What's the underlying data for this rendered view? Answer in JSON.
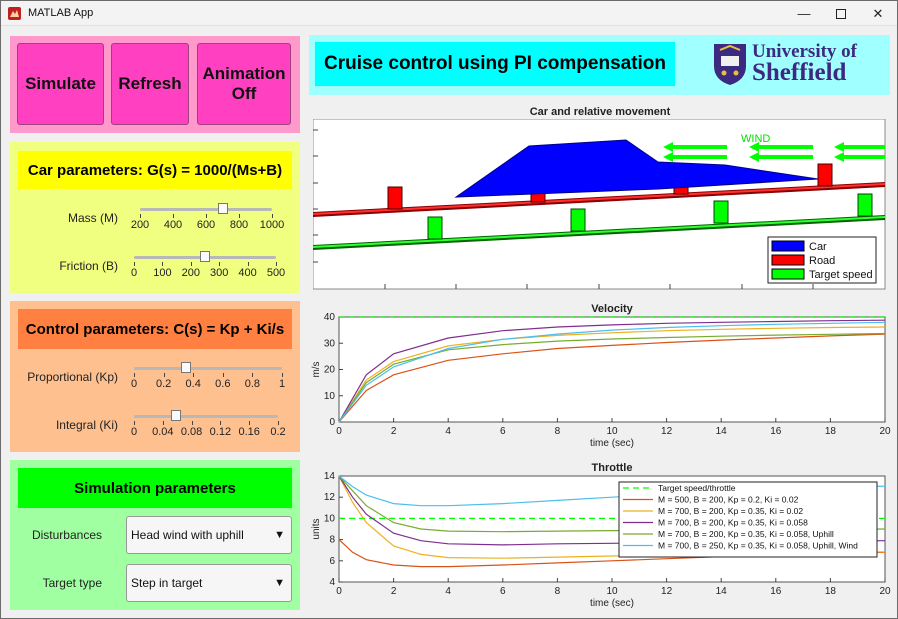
{
  "window": {
    "title": "MATLAB App"
  },
  "buttons": {
    "simulate": "Simulate",
    "refresh": "Refresh",
    "animation_line1": "Animation",
    "animation_line2": "Off"
  },
  "header": {
    "title": "Cruise control using PI compensation",
    "logo_line1": "University of",
    "logo_line2": "Sheffield"
  },
  "car_params": {
    "title": "Car parameters:  G(s) = 1000/(Ms+B)",
    "mass_label": "Mass (M)",
    "mass_ticks": [
      "200",
      "400",
      "600",
      "800",
      "1000"
    ],
    "mass_value": 700,
    "mass_min": 200,
    "mass_max": 1000,
    "friction_label": "Friction (B)",
    "friction_ticks": [
      "0",
      "100",
      "200",
      "300",
      "400",
      "500"
    ],
    "friction_value": 250,
    "friction_min": 0,
    "friction_max": 500
  },
  "control_params": {
    "title": "Control parameters: C(s) = Kp + Ki/s",
    "kp_label": "Proportional (Kp)",
    "kp_ticks": [
      "0",
      "0.2",
      "0.4",
      "0.6",
      "0.8",
      "1"
    ],
    "kp_value": 0.35,
    "kp_min": 0,
    "kp_max": 1,
    "ki_label": "Integral (Ki)",
    "ki_ticks": [
      "0",
      "0.04",
      "0.08",
      "0.12",
      "0.16",
      "0.2"
    ],
    "ki_value": 0.058,
    "ki_min": 0,
    "ki_max": 0.2
  },
  "sim_params": {
    "title": "Simulation parameters",
    "disturbances_label": "Disturbances",
    "disturbances_value": "Head wind with uphill",
    "target_label": "Target type",
    "target_value": "Step in target"
  },
  "colors": {
    "pink": "#ff40c0",
    "yellow": "#ffff00",
    "orange": "#ff8040",
    "green": "#00ff00",
    "cyan": "#00ffff"
  },
  "chart_data": [
    {
      "type": "animation",
      "title": "Car and relative movement",
      "wind_label": "WIND",
      "legend": [
        "Car",
        "Road",
        "Target speed"
      ],
      "legend_colors": [
        "#0000ff",
        "#ff0000",
        "#00ff00"
      ]
    },
    {
      "type": "line",
      "title": "Velocity",
      "xlabel": "time (sec)",
      "ylabel": "m/s",
      "xlim": [
        0,
        20
      ],
      "ylim": [
        0,
        40
      ],
      "xticks": [
        "0",
        "2",
        "4",
        "6",
        "8",
        "10",
        "12",
        "14",
        "16",
        "18",
        "20"
      ],
      "yticks": [
        "0",
        "10",
        "20",
        "30",
        "40"
      ],
      "target": 40,
      "series": [
        {
          "color": "#d95319",
          "x": [
            0,
            1,
            2,
            4,
            6,
            8,
            10,
            12,
            14,
            16,
            18,
            20
          ],
          "values": [
            0,
            12,
            18,
            23.5,
            26,
            28,
            29.2,
            30.3,
            31.2,
            32,
            32.8,
            33.5
          ]
        },
        {
          "color": "#edb120",
          "x": [
            0,
            1,
            2,
            4,
            6,
            8,
            10,
            12,
            14,
            16,
            18,
            20
          ],
          "values": [
            0,
            16,
            23,
            29,
            31.5,
            33,
            34,
            34.8,
            35.3,
            35.7,
            36,
            36.2
          ]
        },
        {
          "color": "#7e2f8e",
          "x": [
            0,
            1,
            2,
            4,
            6,
            8,
            10,
            12,
            14,
            16,
            18,
            20
          ],
          "values": [
            0,
            18,
            26,
            32,
            34.8,
            36.2,
            37,
            37.6,
            38,
            38.3,
            38.6,
            38.8
          ]
        },
        {
          "color": "#77ac30",
          "x": [
            0,
            1,
            2,
            4,
            6,
            8,
            10,
            12,
            14,
            16,
            18,
            20
          ],
          "values": [
            0,
            15,
            22,
            27.5,
            29.5,
            30.8,
            31.6,
            32.2,
            32.7,
            33.1,
            33.4,
            33.7
          ]
        },
        {
          "color": "#4dbeee",
          "x": [
            0,
            1,
            2,
            4,
            6,
            8,
            10,
            12,
            14,
            16,
            18,
            20
          ],
          "values": [
            0,
            14,
            21,
            28,
            31.5,
            33.5,
            35,
            36,
            36.7,
            37.2,
            37.6,
            38
          ]
        }
      ]
    },
    {
      "type": "line",
      "title": "Throttle",
      "xlabel": "time (sec)",
      "ylabel": "units",
      "xlim": [
        0,
        20
      ],
      "ylim": [
        4,
        14
      ],
      "xticks": [
        "0",
        "2",
        "4",
        "6",
        "8",
        "10",
        "12",
        "14",
        "16",
        "18",
        "20"
      ],
      "yticks": [
        "4",
        "6",
        "8",
        "10",
        "12",
        "14"
      ],
      "target": 10,
      "series": [
        {
          "name": "Target speed/throttle",
          "color": "#00ff00",
          "dashed": true,
          "x": [
            0,
            20
          ],
          "values": [
            10,
            10
          ]
        },
        {
          "name": "M = 500, B = 200, Kp = 0.2, Ki = 0.02",
          "color": "#d95319",
          "x": [
            0,
            0.5,
            1,
            2,
            3,
            4,
            6,
            8,
            10,
            12,
            14,
            16,
            18,
            20
          ],
          "values": [
            8,
            6.8,
            6.1,
            5.6,
            5.45,
            5.45,
            5.6,
            5.8,
            6.0,
            6.2,
            6.4,
            6.55,
            6.7,
            6.8
          ]
        },
        {
          "name": "M = 700, B = 200, Kp = 0.35, Ki = 0.02",
          "color": "#edb120",
          "x": [
            0,
            0.5,
            1,
            2,
            3,
            4,
            6,
            8,
            10,
            12,
            14,
            16,
            18,
            20
          ],
          "values": [
            14,
            11.5,
            9.6,
            7.4,
            6.6,
            6.3,
            6.25,
            6.35,
            6.45,
            6.55,
            6.65,
            6.75,
            6.8,
            6.85
          ]
        },
        {
          "name": "M = 700, B = 200, Kp = 0.35, Ki = 0.058",
          "color": "#7e2f8e",
          "x": [
            0,
            0.5,
            1,
            2,
            3,
            4,
            6,
            8,
            10,
            12,
            14,
            16,
            18,
            20
          ],
          "values": [
            14,
            12,
            10.4,
            8.6,
            7.9,
            7.6,
            7.5,
            7.6,
            7.65,
            7.7,
            7.75,
            7.8,
            7.85,
            7.9
          ]
        },
        {
          "name": "M = 700, B = 200, Kp = 0.35, Ki = 0.058, Uphill",
          "color": "#77ac30",
          "x": [
            0,
            0.5,
            1,
            2,
            3,
            4,
            6,
            8,
            10,
            12,
            14,
            16,
            18,
            20
          ],
          "values": [
            14,
            12.6,
            11.2,
            9.6,
            9.0,
            8.8,
            8.75,
            8.8,
            8.85,
            8.85,
            8.9,
            8.9,
            8.95,
            9.0
          ]
        },
        {
          "name": "M = 700, B = 250, Kp = 0.35, Ki = 0.058, Uphill, Wind",
          "color": "#4dbeee",
          "x": [
            0,
            0.5,
            1,
            2,
            3,
            4,
            6,
            8,
            10,
            12,
            14,
            16,
            18,
            20
          ],
          "values": [
            14,
            13,
            12.2,
            11.4,
            11.2,
            11.2,
            11.4,
            11.7,
            12.0,
            12.3,
            12.55,
            12.75,
            12.9,
            13.05
          ]
        }
      ]
    }
  ]
}
